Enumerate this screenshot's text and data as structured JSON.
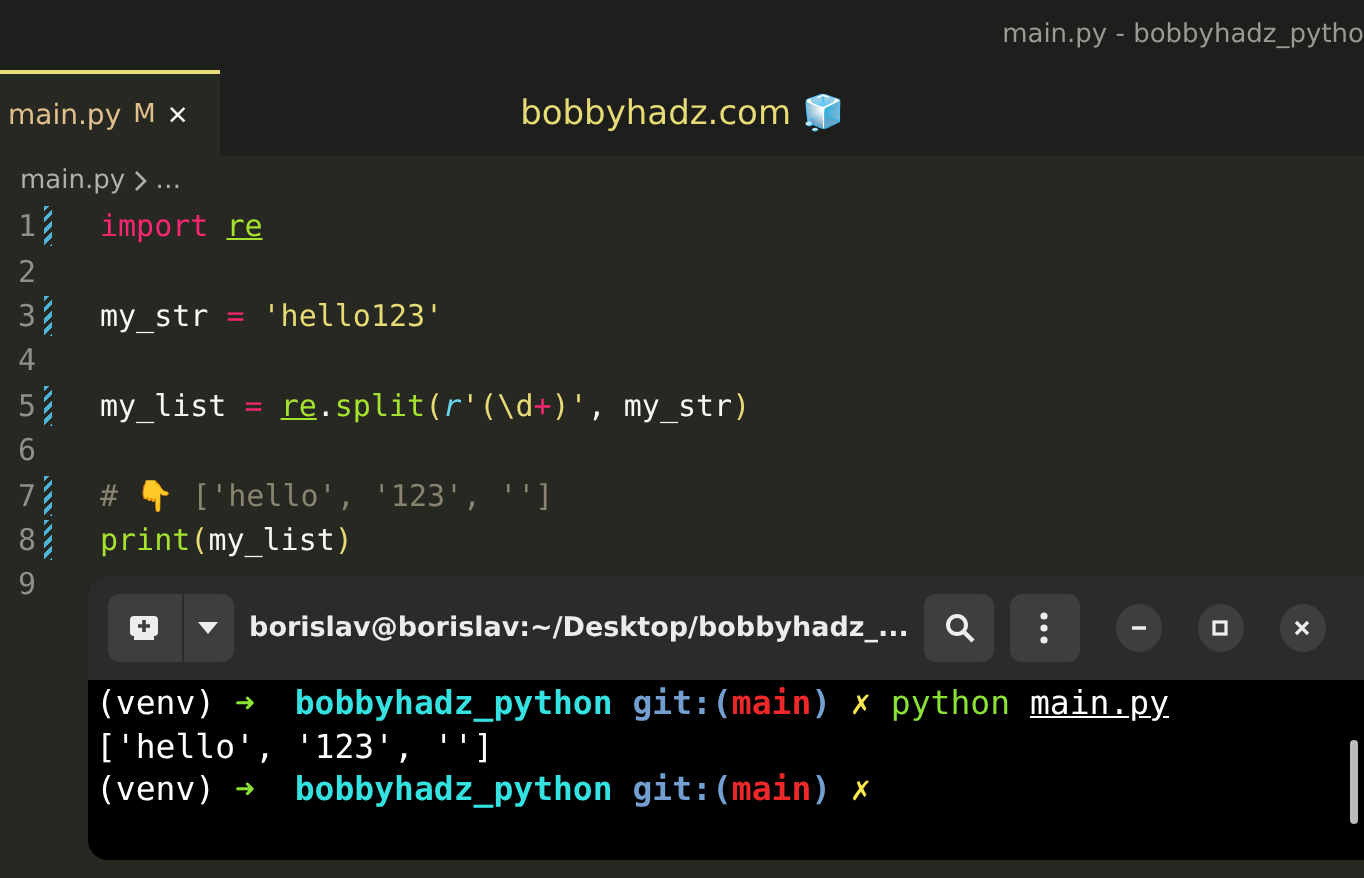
{
  "window": {
    "title": "main.py - bobbyhadz_pytho"
  },
  "tabs": [
    {
      "label": "main.py",
      "badge": "M",
      "close": "×",
      "selected": true
    }
  ],
  "banner": "bobbyhadz.com 🧊",
  "breadcrumb": {
    "file": "main.py",
    "more": "…"
  },
  "editor": {
    "lines": [
      {
        "number": "1",
        "tokens": [
          {
            "t": "import ",
            "kind": "keyword"
          },
          {
            "t": "re",
            "kind": "module"
          }
        ]
      },
      {
        "number": "2"
      },
      {
        "number": "3",
        "tokens": [
          {
            "t": "my_str ",
            "kind": "plain"
          },
          {
            "t": "= ",
            "kind": "op"
          },
          {
            "t": "'hello123'",
            "kind": "string"
          }
        ]
      },
      {
        "number": "4"
      },
      {
        "number": "5",
        "tokens": [
          {
            "t": "my_list ",
            "kind": "plain"
          },
          {
            "t": "= ",
            "kind": "op"
          },
          {
            "t": "re",
            "kind": "module"
          },
          {
            "t": ".",
            "kind": "plain"
          },
          {
            "t": "split",
            "kind": "func"
          },
          {
            "t": "(",
            "kind": "paren"
          },
          {
            "t": "r",
            "kind": "prefix"
          },
          {
            "t": "'(\\d",
            "kind": "string"
          },
          {
            "t": "+",
            "kind": "op"
          },
          {
            "t": ")'",
            "kind": "string"
          },
          {
            "t": ", my_str",
            "kind": "plain"
          },
          {
            "t": ")",
            "kind": "paren"
          }
        ]
      },
      {
        "number": "6"
      },
      {
        "number": "7",
        "tokens": [
          {
            "t": "# 👇 ['hello', '123', '']",
            "kind": "comment"
          }
        ]
      },
      {
        "number": "8",
        "tokens": [
          {
            "t": "print",
            "kind": "func"
          },
          {
            "t": "(",
            "kind": "paren"
          },
          {
            "t": "my_list",
            "kind": "plain"
          },
          {
            "t": ")",
            "kind": "paren"
          }
        ]
      },
      {
        "number": "9"
      }
    ]
  },
  "terminal": {
    "title": "borislav@borislav:~/Desktop/bobbyhadz_...",
    "lines": [
      [
        {
          "t": "(venv) ",
          "kind": "plain"
        },
        {
          "t": "➜  ",
          "kind": "arrow"
        },
        {
          "t": "bobbyhadz_python ",
          "kind": "dir"
        },
        {
          "t": "git:(",
          "kind": "git"
        },
        {
          "t": "main",
          "kind": "branch"
        },
        {
          "t": ") ",
          "kind": "git"
        },
        {
          "t": "✗ ",
          "kind": "dirty"
        },
        {
          "t": "python ",
          "kind": "command"
        },
        {
          "t": "main.py",
          "kind": "path"
        }
      ],
      [
        {
          "t": "['hello', '123', '']",
          "kind": "plain"
        }
      ],
      [
        {
          "t": "(venv) ",
          "kind": "plain"
        },
        {
          "t": "➜  ",
          "kind": "arrow"
        },
        {
          "t": "bobbyhadz_python ",
          "kind": "dir"
        },
        {
          "t": "git:(",
          "kind": "git"
        },
        {
          "t": "main",
          "kind": "branch"
        },
        {
          "t": ") ",
          "kind": "git"
        },
        {
          "t": "✗",
          "kind": "dirty"
        }
      ]
    ]
  }
}
